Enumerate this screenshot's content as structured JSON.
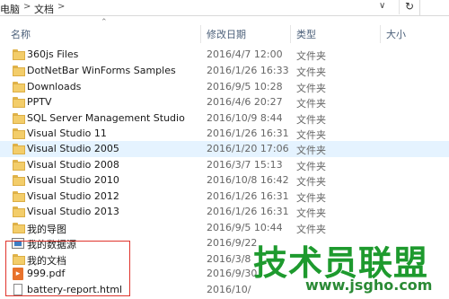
{
  "address": {
    "crumb1": "电脑",
    "crumb2": "文档",
    "sep": ">"
  },
  "columns": {
    "name": "名称",
    "date": "修改日期",
    "type": "类型",
    "size": "大小"
  },
  "rows": [
    {
      "name": "360js Files",
      "date": "2016/4/7 12:00",
      "type": "文件夹",
      "icon": "folder-icon"
    },
    {
      "name": "DotNetBar WinForms Samples",
      "date": "2016/1/26 16:33",
      "type": "文件夹",
      "icon": "folder-icon"
    },
    {
      "name": "Downloads",
      "date": "2016/9/5 10:28",
      "type": "文件夹",
      "icon": "folder-icon"
    },
    {
      "name": "PPTV",
      "date": "2016/4/6 20:27",
      "type": "文件夹",
      "icon": "folder-icon"
    },
    {
      "name": "SQL Server Management Studio",
      "date": "2016/10/9 8:44",
      "type": "文件夹",
      "icon": "folder-icon"
    },
    {
      "name": "Visual Studio 11",
      "date": "2016/1/26 16:31",
      "type": "文件夹",
      "icon": "folder-icon"
    },
    {
      "name": "Visual Studio 2005",
      "date": "2016/1/20 17:06",
      "type": "文件夹",
      "icon": "folder-icon",
      "selected": true
    },
    {
      "name": "Visual Studio 2008",
      "date": "2016/3/7 15:13",
      "type": "文件夹",
      "icon": "folder-icon"
    },
    {
      "name": "Visual Studio 2010",
      "date": "2016/10/8 16:42",
      "type": "文件夹",
      "icon": "folder-icon"
    },
    {
      "name": "Visual Studio 2012",
      "date": "2016/1/26 16:31",
      "type": "文件夹",
      "icon": "folder-icon"
    },
    {
      "name": "Visual Studio 2013",
      "date": "2016/1/26 16:31",
      "type": "文件夹",
      "icon": "folder-icon"
    },
    {
      "name": "我的导图",
      "date": "2016/9/5 10:44",
      "type": "文件夹",
      "icon": "folder-icon"
    },
    {
      "name": "我的数据源",
      "date": "2016/9/22",
      "type": "",
      "icon": "datasource-icon"
    },
    {
      "name": "我的文档",
      "date": "2016/3/8",
      "type": "",
      "icon": "folder-icon"
    },
    {
      "name": "999.pdf",
      "date": "2016/9/30",
      "type": "",
      "icon": "pdf-icon"
    },
    {
      "name": "battery-report.html",
      "date": "2016/10/",
      "type": "",
      "icon": "html-file-icon"
    }
  ],
  "watermark": {
    "big": "技术员联盟",
    "small": "www.jsgho.com"
  },
  "colors": {
    "folder": "#f3cd6a",
    "selection": "#e5f3ff",
    "highlight_box": "#e0342c",
    "watermark": "#1e9a2e"
  }
}
